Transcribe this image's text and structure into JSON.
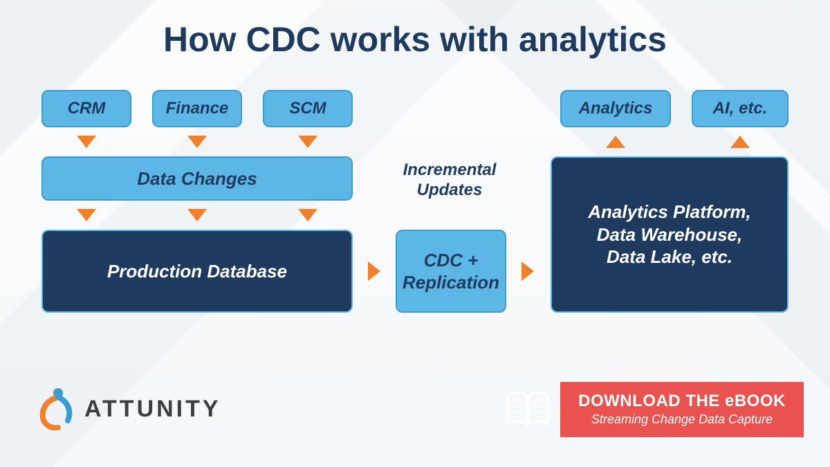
{
  "title": "How CDC works with analytics",
  "sources": [
    "CRM",
    "Finance",
    "SCM"
  ],
  "data_changes_label": "Data Changes",
  "production_db_label": "Production Database",
  "incremental_label": "Incremental\nUpdates",
  "cdc_label": "CDC +\nReplication",
  "outputs": [
    "Analytics",
    "AI, etc."
  ],
  "platform_label": "Analytics Platform,\nData Warehouse,\nData Lake, etc.",
  "logo_text": "ATTUNITY",
  "cta": {
    "line1": "DOWNLOAD THE eBOOK",
    "line2": "Streaming Change Data Capture"
  },
  "colors": {
    "title": "#1f3a5f",
    "light_box": "#5cb7e6",
    "dark_box": "#1f3a5f",
    "arrow": "#f0802b",
    "cta": "#e9524f",
    "logo_orange": "#f0802b",
    "logo_blue": "#3a9bd0"
  }
}
